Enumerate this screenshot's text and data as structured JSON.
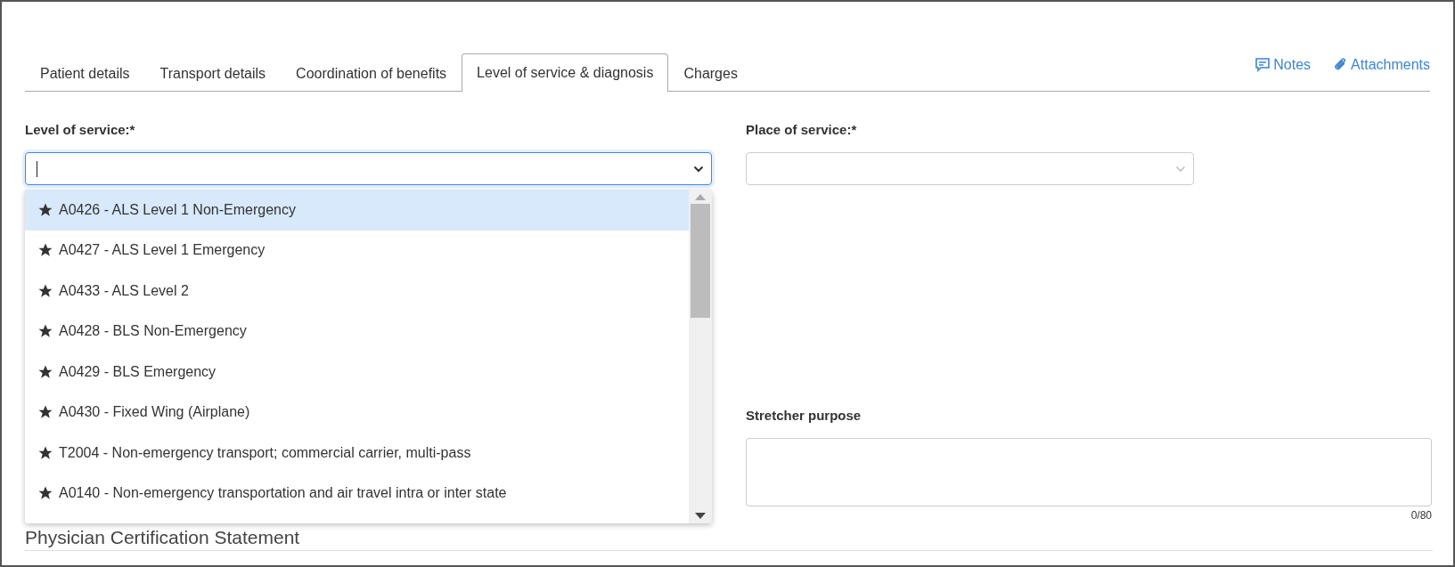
{
  "tabs": [
    {
      "label": "Patient details",
      "selected": false
    },
    {
      "label": "Transport details",
      "selected": false
    },
    {
      "label": "Coordination of benefits",
      "selected": false
    },
    {
      "label": "Level of service & diagnosis",
      "selected": true
    },
    {
      "label": "Charges",
      "selected": false
    }
  ],
  "header_links": [
    {
      "kind": "notes",
      "label": "Notes"
    },
    {
      "kind": "attachments",
      "label": "Attachments"
    }
  ],
  "level_of_service": {
    "label": "Level of service:*",
    "expanded": true,
    "options": [
      {
        "label": "A0426 - ALS Level 1 Non-Emergency",
        "selected": true
      },
      {
        "label": "A0427 - ALS Level 1 Emergency",
        "selected": false
      },
      {
        "label": "A0433 - ALS Level 2",
        "selected": false
      },
      {
        "label": "A0428 - BLS Non-Emergency",
        "selected": false
      },
      {
        "label": "A0429 - BLS Emergency",
        "selected": false
      },
      {
        "label": "A0430 - Fixed Wing (Airplane)",
        "selected": false
      },
      {
        "label": "T2004 - Non-emergency transport; commercial carrier, multi-pass",
        "selected": false
      },
      {
        "label": "A0140 - Non-emergency transportation and air travel intra or inter state",
        "selected": false
      }
    ]
  },
  "place_of_service": {
    "label": "Place of service:*"
  },
  "stretcher_purpose": {
    "label": "Stretcher purpose",
    "counter": "0/80"
  },
  "section_heading": "Physician Certification Statement"
}
